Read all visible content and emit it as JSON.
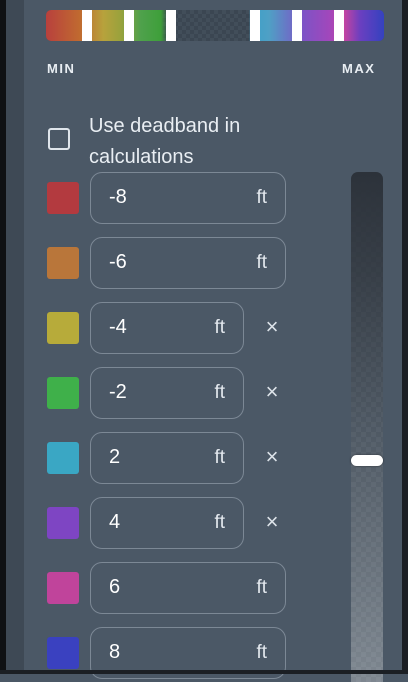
{
  "legend": {
    "min_label": "MIN",
    "max_label": "MAX"
  },
  "deadband": {
    "label": "Use deadband in calculations",
    "checked": false
  },
  "thresholds": [
    {
      "value": "-8",
      "unit": "ft",
      "color": "#b33a3f",
      "removable": false
    },
    {
      "value": "-6",
      "unit": "ft",
      "color": "#b9763a",
      "removable": false
    },
    {
      "value": "-4",
      "unit": "ft",
      "color": "#b7ab3a",
      "removable": true,
      "remove_label": "×"
    },
    {
      "value": "-2",
      "unit": "ft",
      "color": "#3fb04a",
      "removable": true,
      "remove_label": "×"
    },
    {
      "value": "2",
      "unit": "ft",
      "color": "#3aa7c4",
      "removable": true,
      "remove_label": "×"
    },
    {
      "value": "4",
      "unit": "ft",
      "color": "#7e45c3",
      "removable": true,
      "remove_label": "×"
    },
    {
      "value": "6",
      "unit": "ft",
      "color": "#c0449b",
      "removable": false
    },
    {
      "value": "8",
      "unit": "ft",
      "color": "#3a41c0",
      "removable": false
    }
  ],
  "opacity_slider": {
    "value_fraction": 0.56
  }
}
